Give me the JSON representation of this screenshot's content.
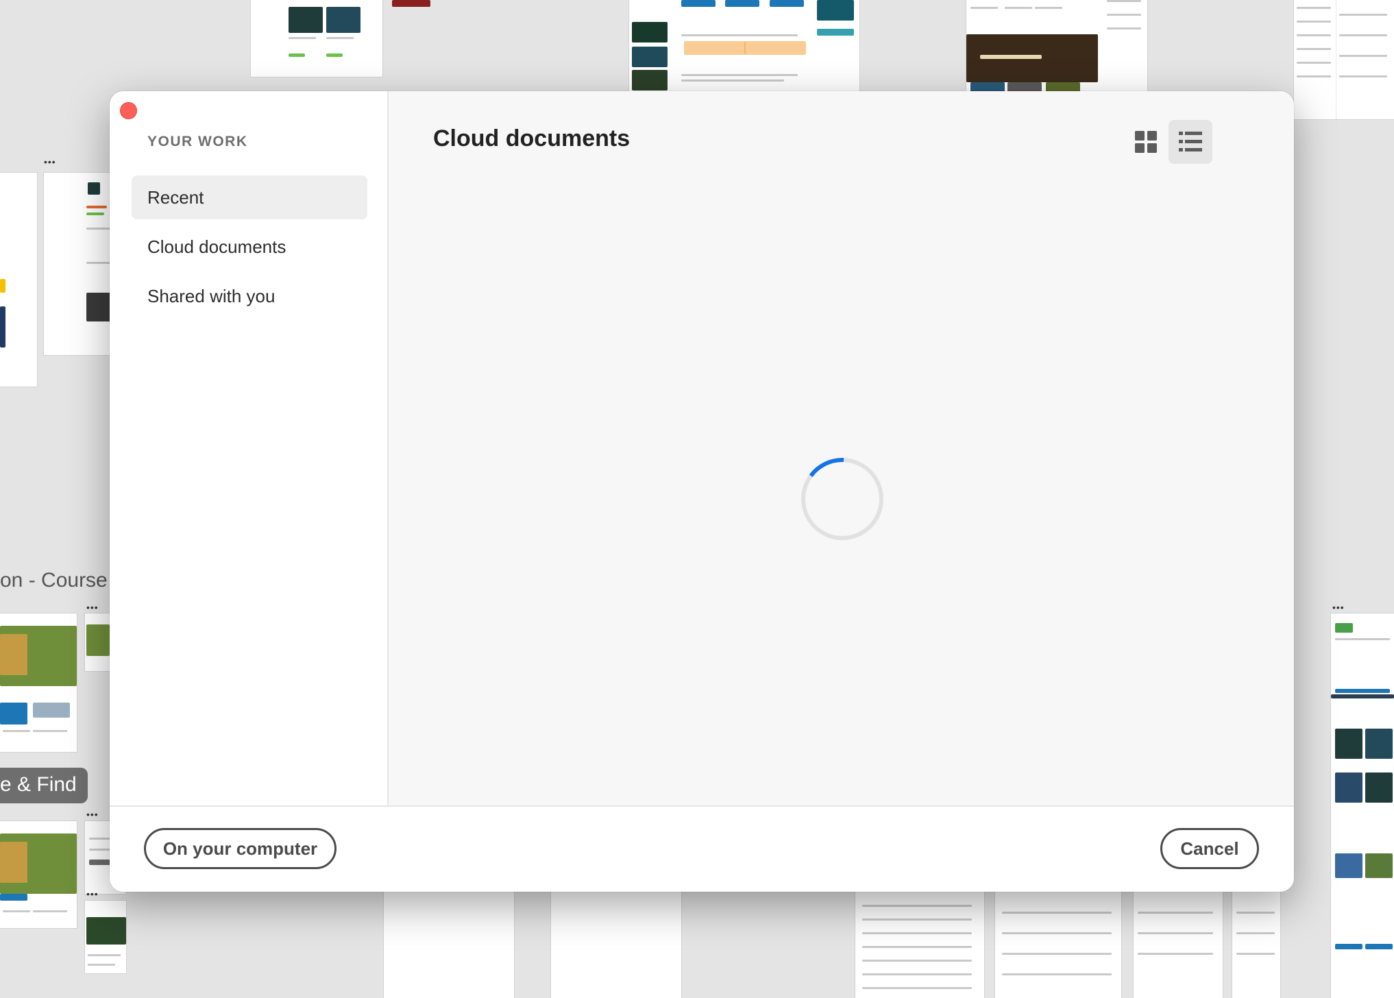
{
  "dialog": {
    "sidebar": {
      "heading": "YOUR WORK",
      "items": [
        {
          "label": "Recent",
          "active": true
        },
        {
          "label": "Cloud documents",
          "active": false
        },
        {
          "label": "Shared with you",
          "active": false
        }
      ]
    },
    "main": {
      "title": "Cloud documents",
      "view_modes": [
        {
          "icon": "grid-view-icon",
          "selected": false
        },
        {
          "icon": "list-view-icon",
          "selected": true
        }
      ],
      "loading": true
    },
    "footer": {
      "secondary_label": "On your computer",
      "cancel_label": "Cancel"
    }
  },
  "canvas": {
    "label_course": "on - Course F",
    "label_find": "e & Find"
  },
  "colors": {
    "close": "#ff5f57",
    "spinner": "#1473e6",
    "spinner_track": "#e1e1e1"
  }
}
